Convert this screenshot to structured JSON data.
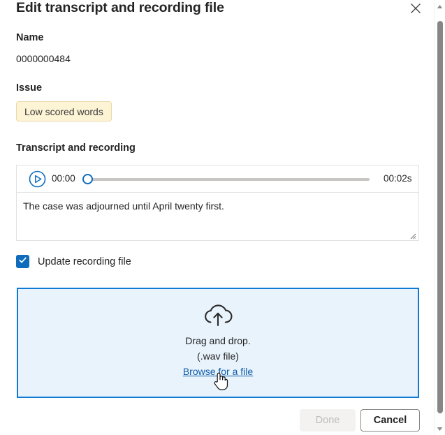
{
  "dialog": {
    "title": "Edit transcript and recording file",
    "close_icon": "close-icon"
  },
  "name_section": {
    "label": "Name",
    "value": "0000000484"
  },
  "issue_section": {
    "label": "Issue",
    "badge": "Low scored words",
    "badge_bg": "#fdf3d5",
    "badge_border": "#e8d9a8"
  },
  "transcript_section": {
    "label": "Transcript and recording",
    "player": {
      "play_icon": "play-icon",
      "current_time": "00:00",
      "total_time": "00:02s",
      "progress_percent": 0,
      "accent_color": "#0f6cbd"
    },
    "text": "The case was adjourned until April twenty first."
  },
  "update_recording": {
    "label": "Update recording file",
    "checked": true,
    "checkbox_color": "#0f6cbd"
  },
  "dropzone": {
    "icon": "cloud-upload-icon",
    "line1": "Drag and drop.",
    "line2": "(.wav file)",
    "link": "Browse for a file",
    "border_color": "#0f7ad4",
    "background_color": "#e9f3fc"
  },
  "footer": {
    "done_label": "Done",
    "done_disabled": true,
    "cancel_label": "Cancel"
  },
  "scrollbar": {
    "up_icon": "scroll-up-arrow-icon",
    "down_icon": "scroll-down-arrow-icon",
    "thumb": "scrollbar-thumb"
  },
  "cursor": {
    "type": "pointing-hand-cursor"
  }
}
